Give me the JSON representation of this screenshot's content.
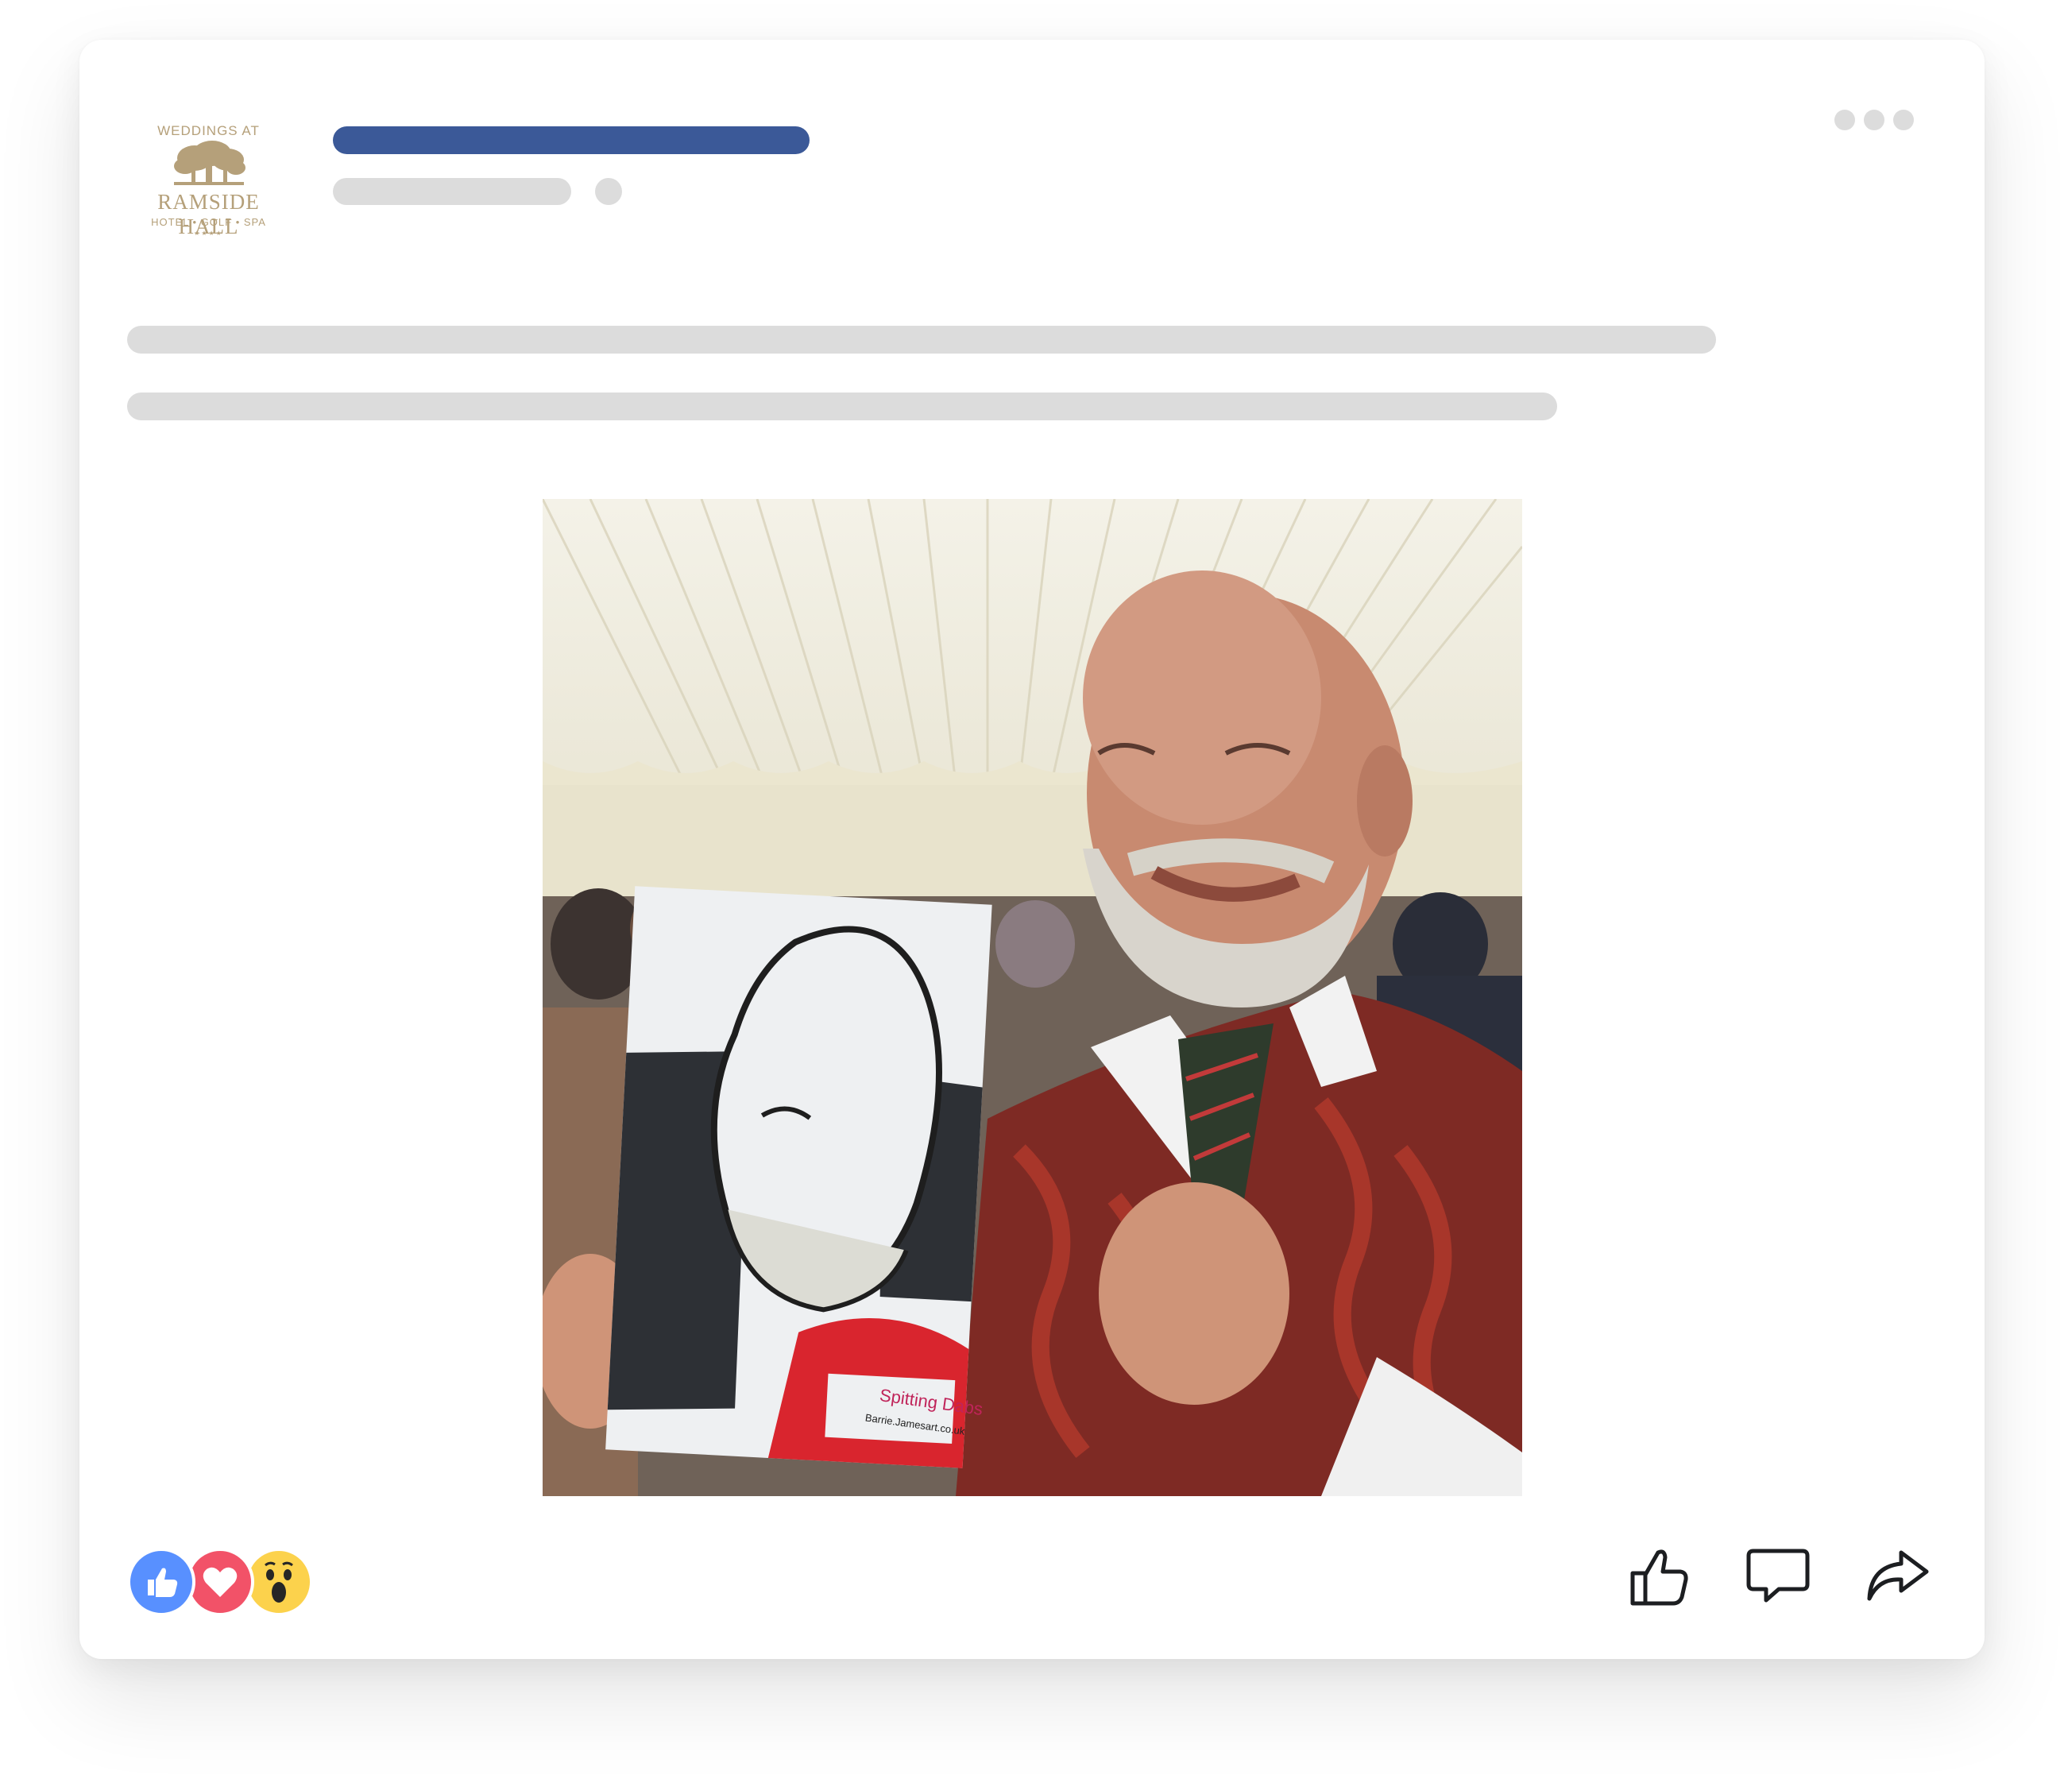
{
  "post": {
    "page_logo": {
      "line1": "WEDDINGS AT",
      "line2": "RAMSIDE HALL",
      "line3": "HOTEL • GOLF • SPA",
      "stars": "★★★★"
    },
    "more_icon": "more-dots-icon",
    "photo": {
      "sign_text": "Spitting Dabs",
      "sign_url": "Barrie.Jamesart.co.uk"
    },
    "reactions": [
      "like-reaction-icon",
      "love-reaction-icon",
      "wow-reaction-icon"
    ],
    "actions": [
      "like-icon",
      "comment-icon",
      "share-icon"
    ]
  },
  "colors": {
    "brand_bar": "#3b5998",
    "placeholder": "#dcdcdc",
    "logo_gold": "#b5a07a",
    "like_blue": "#5890ff",
    "love_red": "#f25268",
    "wow_yellow": "#fcd24c"
  }
}
